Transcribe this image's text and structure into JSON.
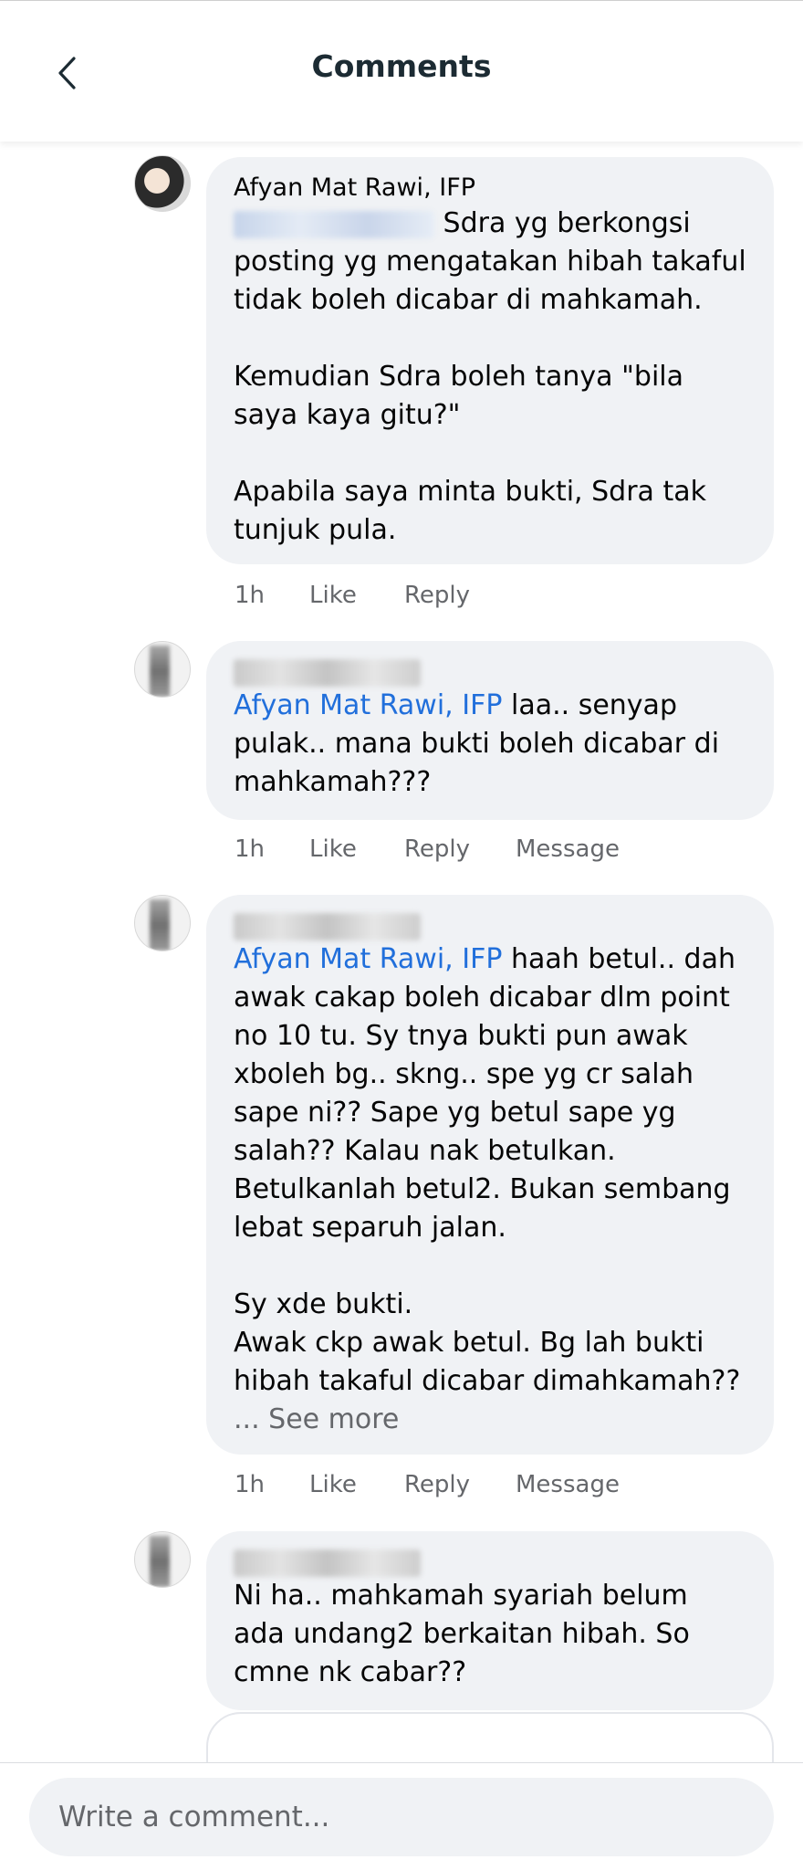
{
  "header": {
    "title": "Comments",
    "back_icon": "chevron-left-icon"
  },
  "comments": [
    {
      "author": "Afyan Mat Rawi, IFP",
      "text": " Sdra yg berkongsi posting yg mengatakan hibah takaful tidak boleh dicabar di mahkamah.\n\nKemudian Sdra boleh tanya \"bila saya kaya gitu?\"\n\nApabila saya minta bukti, Sdra tak tunjuk pula.",
      "time": "1h",
      "like": "Like",
      "reply": "Reply"
    },
    {
      "mention": "Afyan Mat Rawi, IFP",
      "text": " laa.. senyap pulak.. mana bukti boleh dicabar di mahkamah???",
      "time": "1h",
      "like": "Like",
      "reply": "Reply",
      "message": "Message"
    },
    {
      "mention": "Afyan Mat Rawi, IFP",
      "text": " haah betul.. dah awak cakap boleh dicabar dlm point no 10 tu. Sy tnya bukti pun awak xboleh bg.. skng.. spe yg cr salah sape ni?? Sape yg betul sape yg salah?? Kalau nak betulkan. Betulkanlah betul2. Bukan sembang lebat separuh jalan.\n\nSy xde bukti.\nAwak ckp awak betul. Bg lah bukti hibah takaful dicabar dimahkamah??",
      "see_more": "... See more",
      "time": "1h",
      "like": "Like",
      "reply": "Reply",
      "message": "Message"
    },
    {
      "text": "Ni ha.. mahkamah syariah belum ada undang2 berkaitan hibah. So cmne nk cabar??"
    }
  ],
  "composer": {
    "placeholder": "Write a comment..."
  }
}
